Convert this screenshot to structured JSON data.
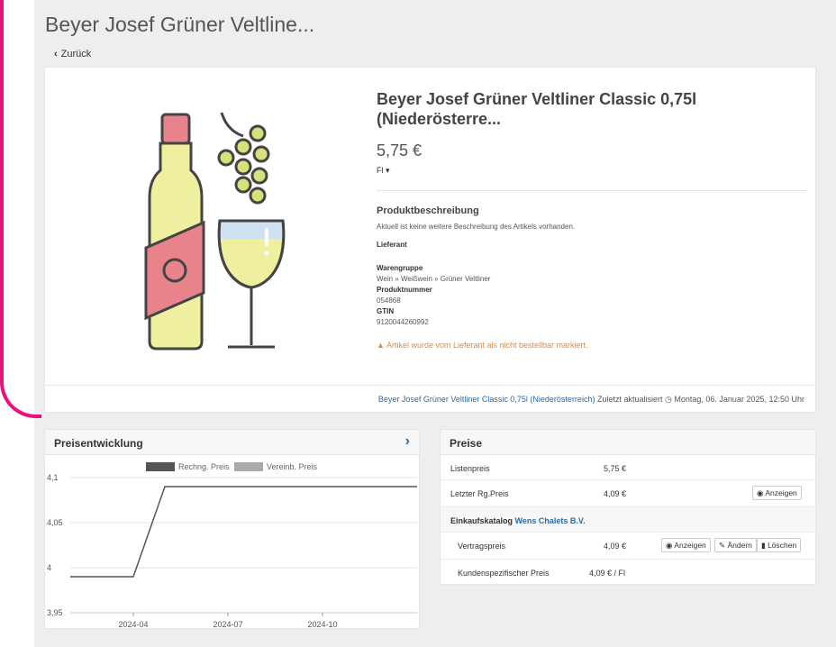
{
  "page": {
    "title": "Beyer Josef Grüner Veltline...",
    "back_label": "Zurück"
  },
  "product": {
    "name": "Beyer Josef Grüner Veltliner Classic 0,75l (Niederösterre...",
    "price": "5,75 €",
    "unit": "Fl",
    "desc_heading": "Produktbeschreibung",
    "desc_text": "Aktuell ist keine weitere Beschreibung des Artikels vorhanden.",
    "supplier_label": "Lieferant",
    "group_label": "Warengruppe",
    "group_value": "Wein » Weißwein » Grüner Veltliner",
    "number_label": "Produktnummer",
    "number_value": "054868",
    "gtin_label": "GTIN",
    "gtin_value": "9120044260992",
    "warning": "Artikel wurde vom Lieferant als nicht bestellbar markiert."
  },
  "footer": {
    "product_link": "Beyer Josef Grüner Veltliner Classic 0,75l (Niederösterreich)",
    "updated_text": "Zuletzt aktualisiert",
    "updated_date": "Montag, 06. Januar 2025, 12:50 Uhr"
  },
  "chart_panel": {
    "title": "Preisentwicklung"
  },
  "chart_data": {
    "type": "line",
    "x_ticks": [
      "2024-04",
      "2024-07",
      "2024-10"
    ],
    "y_ticks": [
      "4,1",
      "4,05",
      "4",
      "3,95"
    ],
    "ylim": [
      3.95,
      4.1
    ],
    "legend": [
      "Rechng. Preis",
      "Vereinb. Preis"
    ],
    "legend_colors": [
      "#555555",
      "#aaaaaa"
    ],
    "series": [
      {
        "name": "Rechng. Preis",
        "points": [
          [
            "2024-02",
            3.99
          ],
          [
            "2024-04",
            3.99
          ],
          [
            "2024-05",
            4.09
          ],
          [
            "2025-01",
            4.09
          ]
        ]
      }
    ]
  },
  "prices": {
    "title": "Preise",
    "list_label": "Listenpreis",
    "list_value": "5,75 €",
    "last_label": "Letzter Rg.Preis",
    "last_value": "4,09 €",
    "show_btn": "Anzeigen",
    "catalog_label": "Einkaufskatalog",
    "catalog_name": "Wens Chalets B.V.",
    "contract_label": "Vertragspreis",
    "contract_value": "4,09 €",
    "show_btn2": "Anzeigen",
    "edit_btn": "Ändern",
    "delete_btn": "Löschen",
    "custom_label": "Kundenspezifischer Preis",
    "custom_value": "4,09 € / Fl"
  }
}
